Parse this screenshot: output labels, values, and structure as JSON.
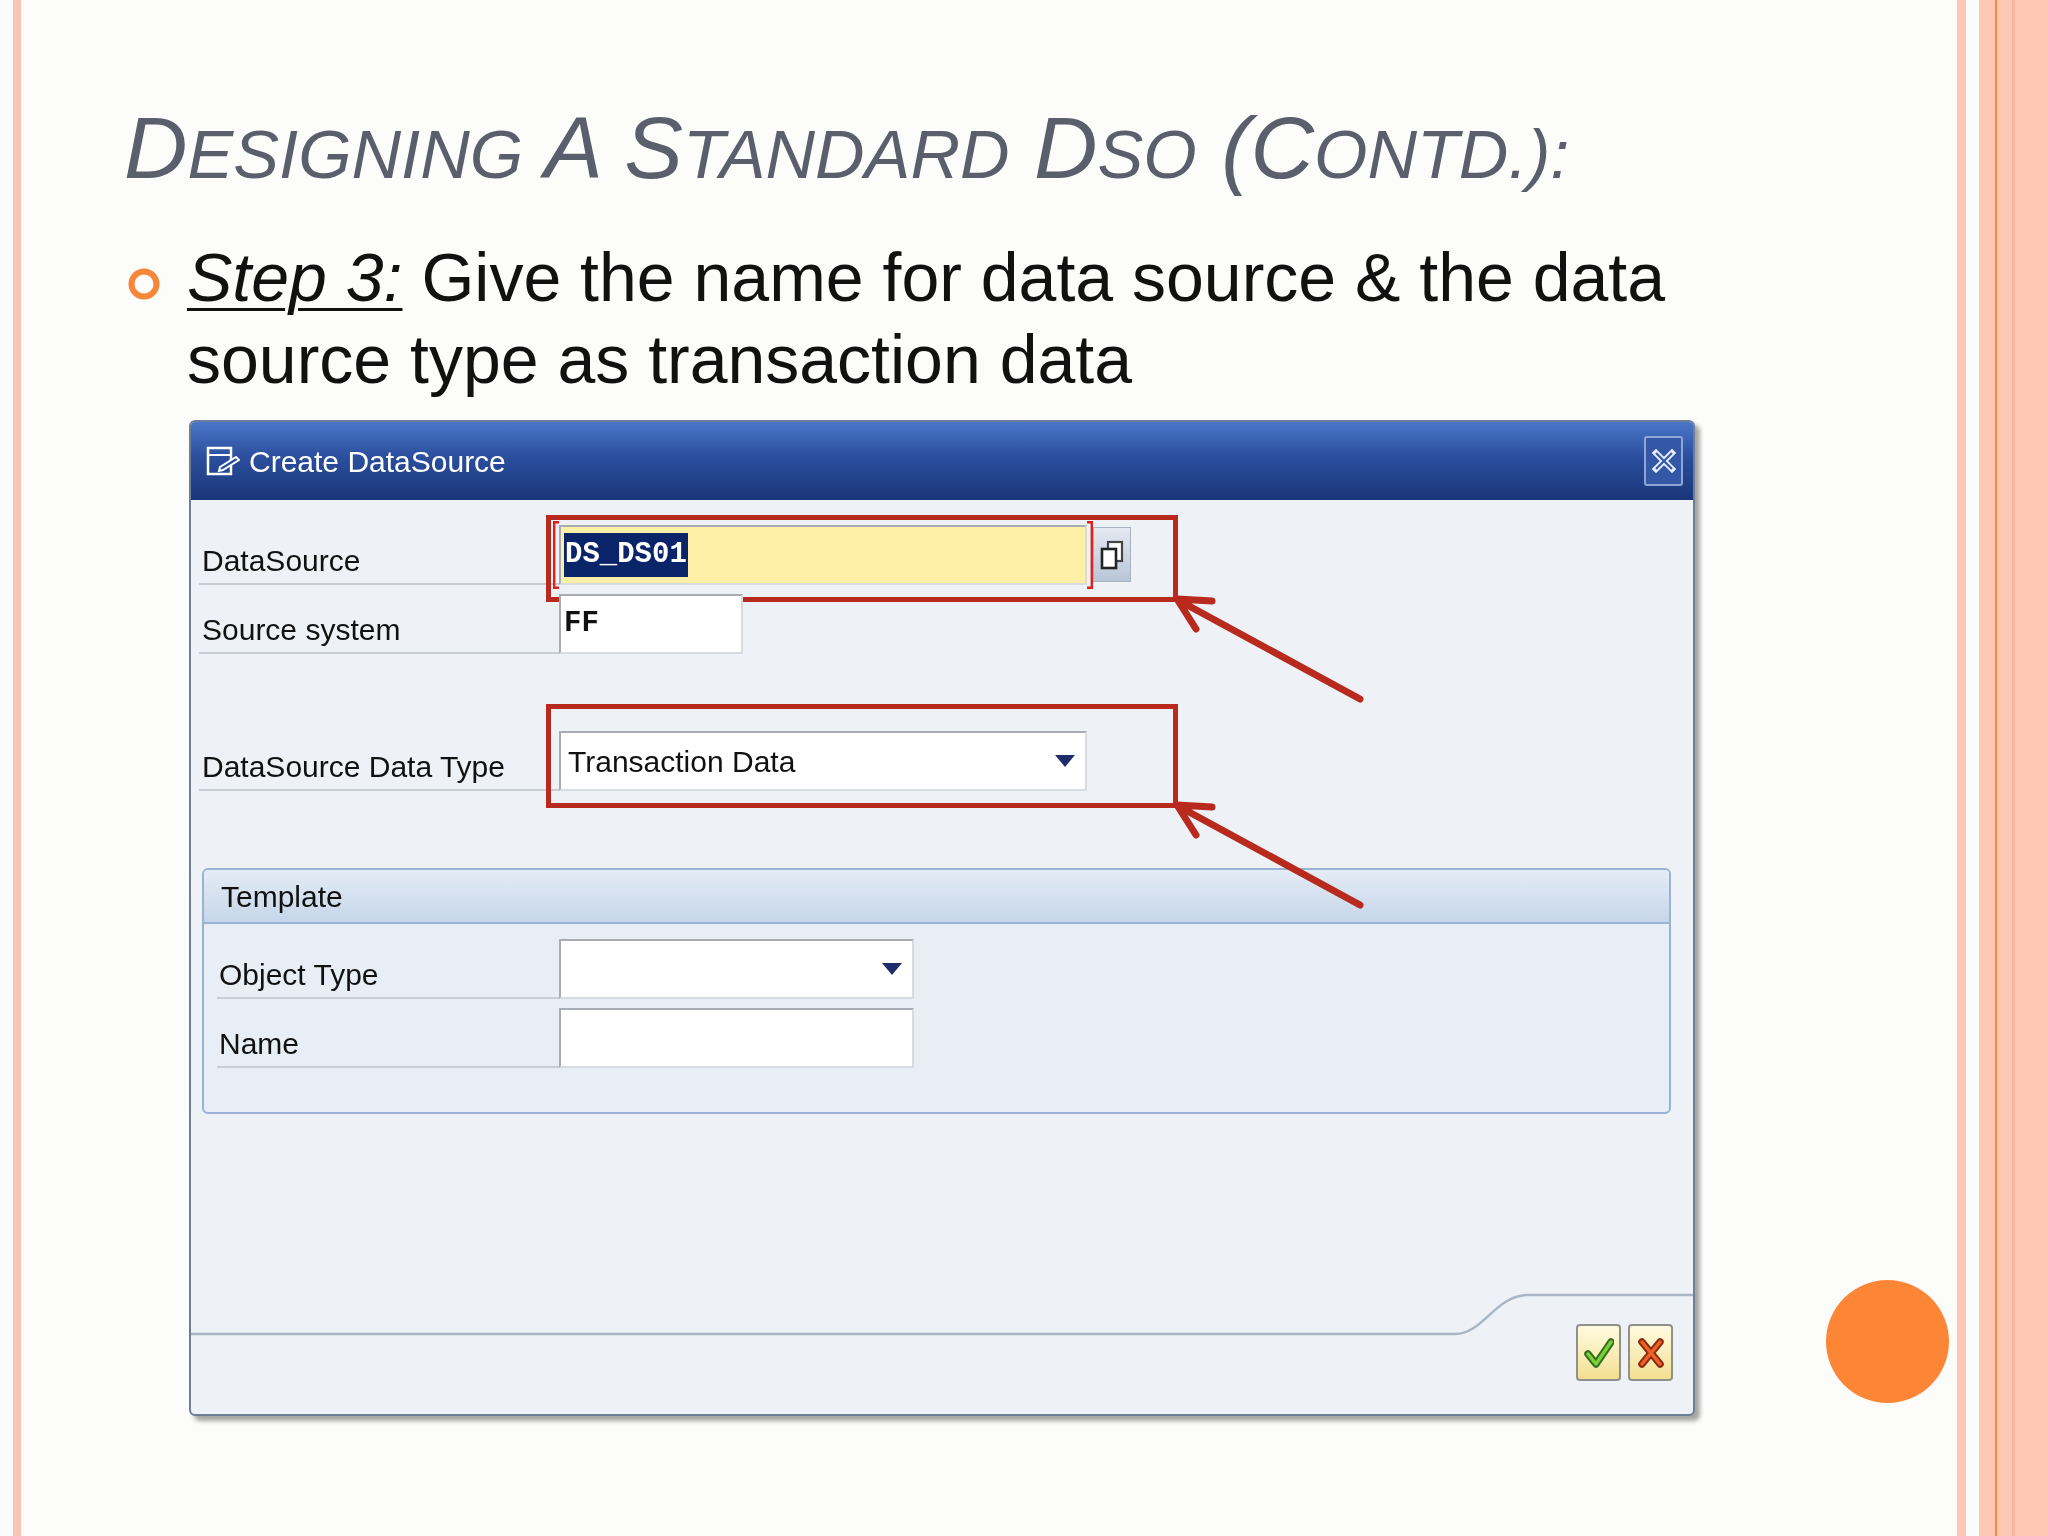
{
  "slide": {
    "title": "DESIGNING A STANDARD DSO (CONTD.):",
    "bullets": [
      "*Step 3:* Give the name for data source & the data source type as transaction data"
    ]
  },
  "dialog": {
    "title": "Create DataSource",
    "sections": [
      {
        "fields": [
          {
            "kind": "input",
            "label": "DataSource",
            "value": "DS_DS01",
            "focused": true,
            "highlighted": true
          },
          {
            "kind": "input",
            "label": "Source system",
            "value": "FF",
            "focused": false,
            "highlighted": false
          }
        ]
      },
      {
        "fields": [
          {
            "kind": "dropdown",
            "label": "DataSource Data Type",
            "value": "Transaction Data",
            "focused": false,
            "highlighted": true
          }
        ]
      }
    ],
    "template": {
      "title": "Template",
      "fields": [
        {
          "kind": "dropdown",
          "label": "Object Type",
          "focused": false,
          "highlighted": false
        },
        {
          "kind": "input",
          "label": "Name",
          "focused": false,
          "highlighted": false
        }
      ]
    },
    "buttons": [
      {
        "kind": "confirm"
      },
      {
        "kind": "cancel"
      }
    ]
  }
}
